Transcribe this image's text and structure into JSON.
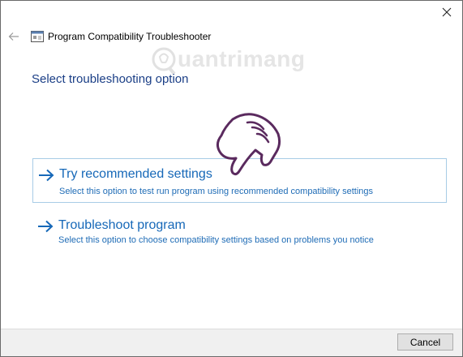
{
  "window": {
    "title": "Program Compatibility Troubleshooter"
  },
  "main": {
    "heading": "Select troubleshooting option",
    "options": [
      {
        "title": "Try recommended settings",
        "description": "Select this option to test run program using recommended compatibility settings",
        "selected": true
      },
      {
        "title": "Troubleshoot program",
        "description": "Select this option to choose compatibility settings based on problems you notice",
        "selected": false
      }
    ]
  },
  "footer": {
    "cancel_label": "Cancel"
  },
  "watermark": {
    "text": "uantrimang"
  },
  "icons": {
    "close": "close-icon",
    "back": "back-arrow-icon",
    "app": "program-window-icon",
    "option_arrow": "arrow-right-icon",
    "pointer": "pointing-hand-icon",
    "watermark_logo": "lightbulb-logo-icon"
  },
  "colors": {
    "heading": "#1a3e86",
    "link": "#1668b8",
    "selected_border": "#a8cce6",
    "footer_bg": "#f0f0f0"
  }
}
